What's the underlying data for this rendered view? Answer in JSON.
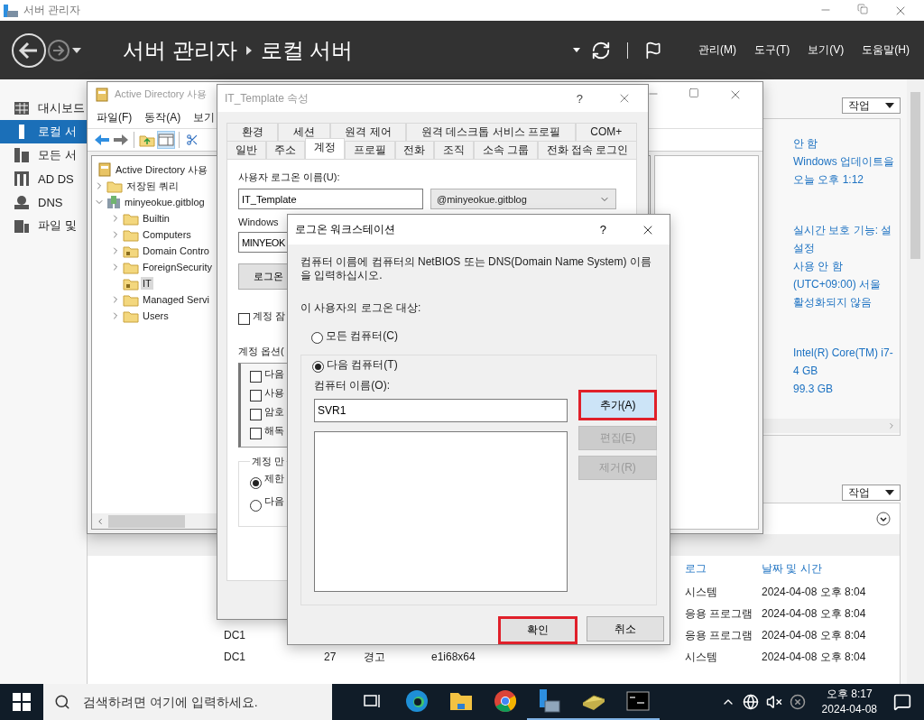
{
  "app_title": "서버 관리자",
  "header": {
    "breadcrumb": [
      "서버 관리자",
      "로컬 서버"
    ],
    "menu": [
      "관리(M)",
      "도구(T)",
      "보기(V)",
      "도움말(H)"
    ]
  },
  "nav": [
    {
      "label": "대시보드",
      "kind": "dashboard",
      "selected": false
    },
    {
      "label": "로컬 서",
      "kind": "server",
      "selected": true
    },
    {
      "label": "모든 서",
      "kind": "servers",
      "selected": false
    },
    {
      "label": "AD DS",
      "kind": "adds",
      "selected": false
    },
    {
      "label": "DNS",
      "kind": "dns",
      "selected": false
    },
    {
      "label": "파일 및",
      "kind": "files",
      "selected": false
    }
  ],
  "properties": {
    "tasks_label": "작업",
    "value_groups": [
      {
        "values": [
          "안 함",
          "Windows 업데이트을",
          "오늘 오후 1:12"
        ]
      },
      {
        "values": [
          "실시간 보호 기능: 설",
          "설정",
          "사용 안 함",
          "(UTC+09:00) 서울",
          "활성화되지 않음"
        ]
      },
      {
        "values": [
          "Intel(R) Core(TM) i7-",
          "4 GB",
          "99.3 GB"
        ]
      }
    ]
  },
  "events": {
    "tasks_label": "작업",
    "columns": [
      "로그",
      "날짜 및 시간"
    ],
    "rows": [
      {
        "log": "시스템",
        "date": "2024-04-08 오후 8:04"
      },
      {
        "log": "응용 프로그램",
        "date": "2024-04-08 오후 8:04"
      },
      {
        "server": "DC1",
        "log": "응용 프로그램",
        "date": "2024-04-08 오후 8:04"
      },
      {
        "server": "DC1",
        "id": "27",
        "level": "경고",
        "source": "e1i68x64",
        "log": "시스템",
        "date": "2024-04-08 오후 8:04"
      }
    ]
  },
  "aduc": {
    "title": "Active Directory 사용",
    "menu": [
      "파일(F)",
      "동작(A)",
      "보기"
    ],
    "tree": [
      {
        "label": "Active Directory 사용",
        "kind": "root",
        "selected": false,
        "children": [
          {
            "label": "저장된 쿼리",
            "kind": "folder",
            "selected": false,
            "expanded": false
          },
          {
            "label": "minyeokue.gitblog",
            "kind": "domain",
            "selected": false,
            "expanded": true,
            "children": [
              {
                "label": "Builtin",
                "kind": "folder",
                "selected": false,
                "expanded": false
              },
              {
                "label": "Computers",
                "kind": "folder",
                "selected": false,
                "expanded": false
              },
              {
                "label": "Domain Contro",
                "kind": "ou",
                "selected": false,
                "expanded": false
              },
              {
                "label": "ForeignSecurity",
                "kind": "folder",
                "selected": false,
                "expanded": false
              },
              {
                "label": "IT",
                "kind": "ou",
                "selected": true
              },
              {
                "label": "Managed Servi",
                "kind": "folder",
                "selected": false,
                "expanded": false
              },
              {
                "label": "Users",
                "kind": "folder",
                "selected": false,
                "expanded": false
              }
            ]
          }
        ]
      }
    ]
  },
  "properties_dialog": {
    "title": "IT_Template 속성",
    "help": "?",
    "tabs_back": [
      {
        "label": "환경",
        "selected": false
      },
      {
        "label": "세션",
        "selected": false
      },
      {
        "label": "원격 제어",
        "selected": false
      },
      {
        "label": "원격 데스크톱 서비스 프로필",
        "selected": false
      },
      {
        "label": "COM+",
        "selected": false
      }
    ],
    "tabs_front": [
      {
        "label": "일반",
        "selected": false
      },
      {
        "label": "주소",
        "selected": false
      },
      {
        "label": "계정",
        "selected": true
      },
      {
        "label": "프로필",
        "selected": false
      },
      {
        "label": "전화",
        "selected": false
      },
      {
        "label": "조직",
        "selected": false
      },
      {
        "label": "소속 그룹",
        "selected": false
      },
      {
        "label": "전화 접속 로그인",
        "selected": false
      }
    ],
    "logon_name_label": "사용자 로그온 이름(U):",
    "logon_name": "IT_Template",
    "domain": "@minyeokue.gitblog",
    "pre2000_label": "Windows",
    "pre2000_value": "MINYEOK",
    "logon_button": "로그온",
    "unlock": {
      "label": "계정 잠",
      "checked": false
    },
    "options_label": "계정 옵션(",
    "options": [
      {
        "label": "다음",
        "checked": false
      },
      {
        "label": "사용",
        "checked": false
      },
      {
        "label": "암호",
        "checked": false
      },
      {
        "label": "해독",
        "checked": false
      }
    ],
    "expiry_label": "계정 만",
    "expiry": [
      {
        "label": "제한",
        "selected": true
      },
      {
        "label": "다음",
        "selected": false
      }
    ]
  },
  "logon_dialog": {
    "title": "로그온 워크스테이션",
    "help": "?",
    "instructions": "컴퓨터 이름에 컴퓨터의 NetBIOS 또는 DNS(Domain Name System) 이름을 입력하십시오.",
    "target_label": "이 사용자의 로그온 대상:",
    "targets": [
      {
        "label": "모든 컴퓨터(C)",
        "selected": false
      },
      {
        "label": "다음 컴퓨터(T)",
        "selected": true
      }
    ],
    "computer_label": "컴퓨터 이름(O):",
    "computer_value": "SVR1",
    "side_buttons": [
      {
        "label": "추가(A)",
        "disabled": false,
        "highlighted": true
      },
      {
        "label": "편집(E)",
        "disabled": true,
        "highlighted": false
      },
      {
        "label": "제거(R)",
        "disabled": true,
        "highlighted": false
      }
    ],
    "footer_buttons": [
      {
        "label": "확인",
        "highlighted": true
      },
      {
        "label": "취소",
        "highlighted": false
      }
    ]
  },
  "taskbar": {
    "search_placeholder": "검색하려면 여기에 입력하세요.",
    "apps": [
      {
        "kind": "taskview",
        "running": false
      },
      {
        "kind": "edge",
        "running": false
      },
      {
        "kind": "explorer",
        "running": false
      },
      {
        "kind": "chrome",
        "running": false
      },
      {
        "kind": "server-manager",
        "running": true
      },
      {
        "kind": "tool",
        "running": true
      },
      {
        "kind": "terminal",
        "running": true
      }
    ],
    "time": "오후 8:17",
    "date": "2024-04-08"
  }
}
